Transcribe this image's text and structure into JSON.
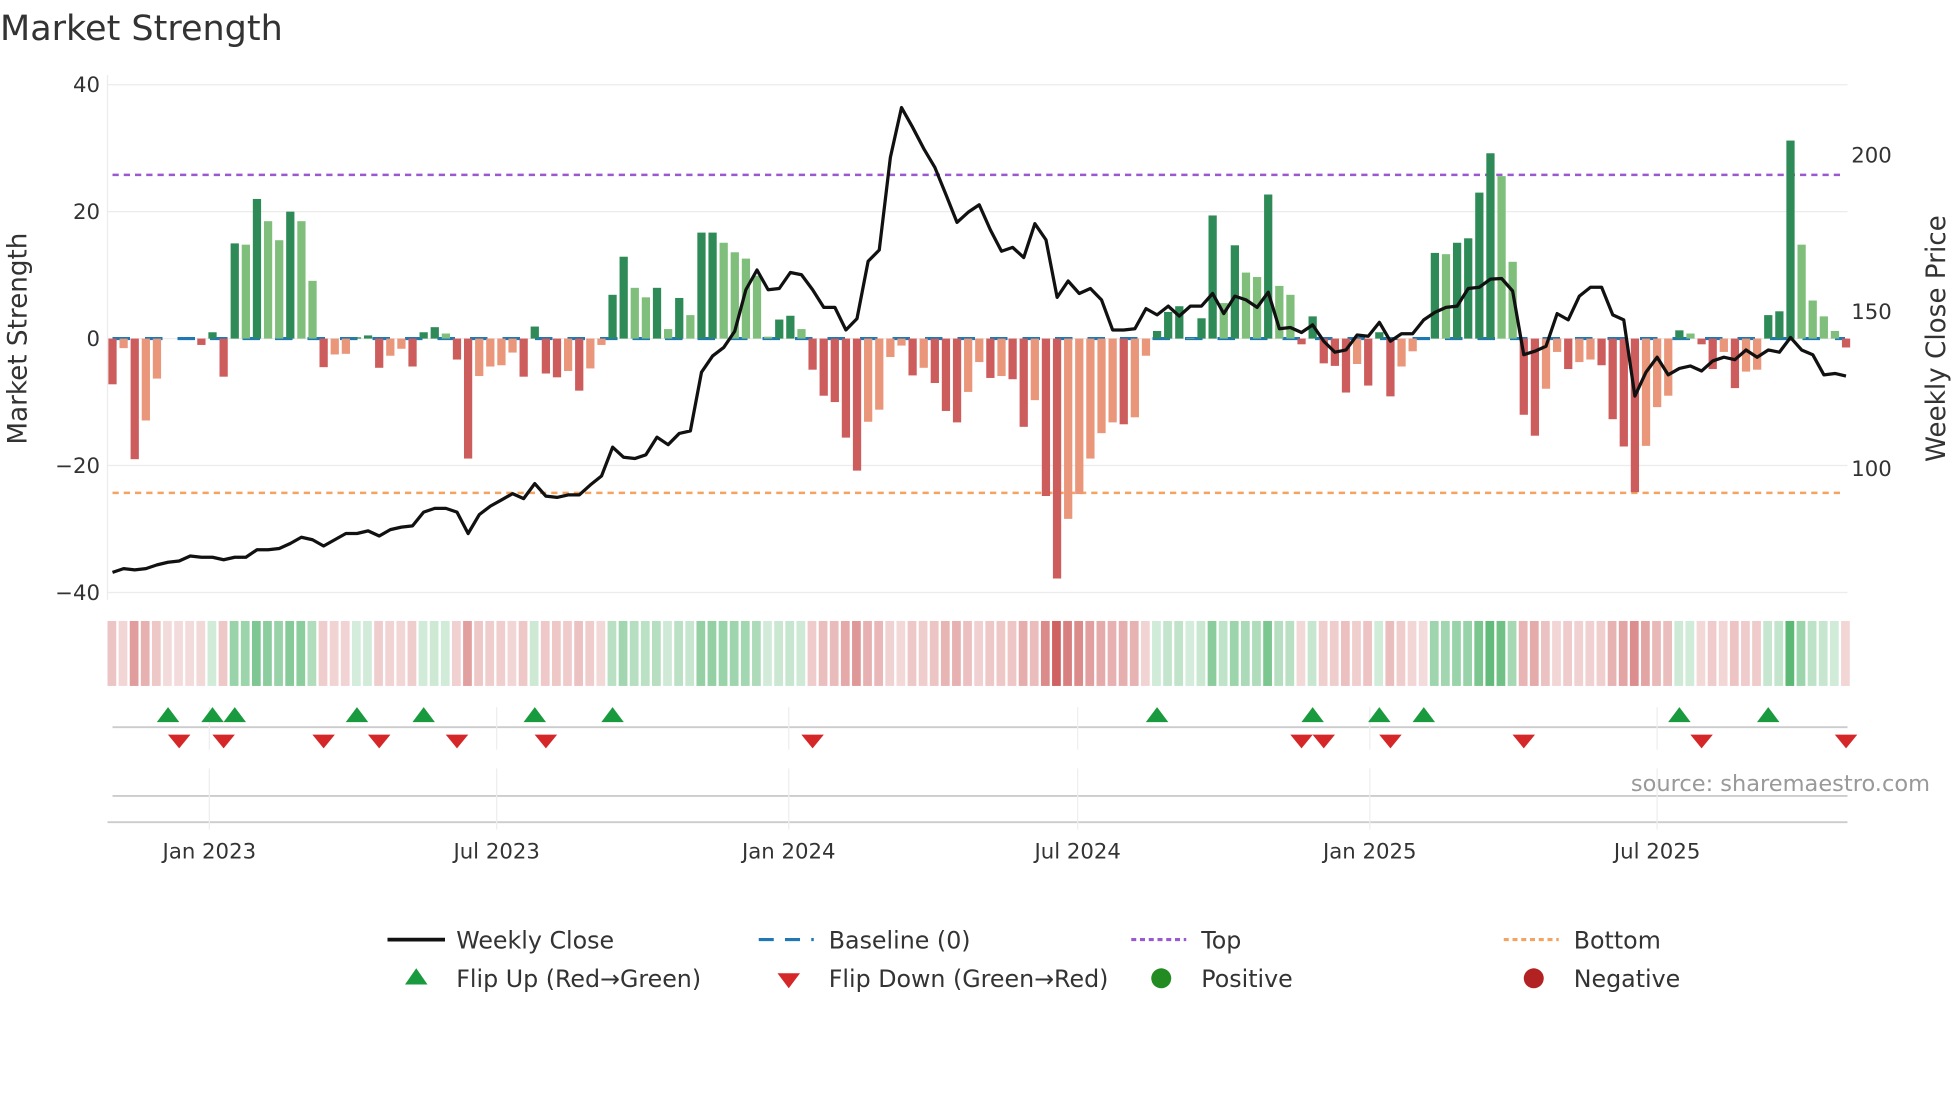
{
  "chart_data": {
    "type": "bar",
    "title": "Market Strength",
    "ylabel_left": "Market Strength",
    "ylabel_right": "Weekly Close Price",
    "ylim_left": [
      -40,
      40
    ],
    "left_ticks": [
      40,
      20,
      0,
      -20,
      -40
    ],
    "left_tick_labels": [
      "40",
      "20",
      "0",
      "−20",
      "−40"
    ],
    "right_ticks": [
      200,
      150,
      100
    ],
    "right_tick_labels": [
      "200",
      "150",
      "100"
    ],
    "x_tick_dates": [
      "2023-01-01",
      "2023-07-01",
      "2024-01-01",
      "2024-07-01",
      "2025-01-01",
      "2025-07-01"
    ],
    "x_tick_labels": [
      "Jan 2023",
      "Jul 2023",
      "Jan 2024",
      "Jul 2024",
      "Jan 2025",
      "Jul 2025"
    ],
    "start_date": "2022-11-01",
    "frequency": "weekly",
    "top_level": 25.8,
    "bottom_level": -24.3,
    "baseline": 0,
    "strength": [
      -7.2,
      -1.5,
      -19,
      -12.9,
      -6.3,
      0,
      0,
      0,
      -1,
      1,
      -6,
      15,
      14.8,
      22,
      18.5,
      15.5,
      20,
      18.5,
      9.1,
      -4.5,
      -2.5,
      -2.4,
      0.2,
      0.5,
      -4.6,
      -2.7,
      -1.6,
      -4.4,
      1,
      1.8,
      0.8,
      -3.3,
      -18.9,
      -5.9,
      -4.4,
      -4.2,
      -2.2,
      -6,
      1.9,
      -5.5,
      -6.1,
      -5.1,
      -8.2,
      -4.7,
      -1,
      6.9,
      12.9,
      8,
      6.5,
      8,
      1.5,
      6.4,
      3.7,
      16.7,
      16.7,
      15.1,
      13.6,
      12.6,
      9.9,
      0.3,
      3,
      3.6,
      1.5,
      -4.9,
      -9,
      -10,
      -15.6,
      -20.8,
      -13.1,
      -11.2,
      -2.9,
      -1.1,
      -5.8,
      -4.6,
      -7,
      -11.4,
      -13.2,
      -8.4,
      -3.7,
      -6.2,
      -5.9,
      -6.4,
      -13.9,
      -9.7,
      -24.8,
      -37.8,
      -28.4,
      -24.5,
      -18.9,
      -14.9,
      -13.2,
      -13.5,
      -12.4,
      -2.7,
      1.2,
      4.2,
      5.1,
      0.1,
      3.2,
      19.4,
      5.6,
      14.7,
      10.4,
      9.7,
      22.7,
      8.3,
      6.9,
      -0.9,
      3.5,
      -3.9,
      -4.3,
      -8.5,
      -4,
      -7.4,
      1,
      -9.1,
      -4.4,
      -2,
      0,
      13.5,
      13.3,
      15.1,
      15.8,
      23,
      29.2,
      25.6,
      12.1,
      -12,
      -15.3,
      -7.9,
      -2.1,
      -4.8,
      -3.7,
      -3.3,
      -4.2,
      -12.7,
      -17,
      -24.2,
      -16.9,
      -10.8,
      -9,
      1.3,
      0.8,
      -0.9,
      -4.8,
      -2.1,
      -7.8,
      -5.2,
      -4.9,
      3.7,
      4.3,
      31.2,
      14.8,
      6,
      3.5,
      1.2,
      -1.4
    ],
    "close": [
      66.9,
      68.1,
      67.7,
      68.1,
      69.3,
      70.1,
      70.5,
      72.1,
      71.7,
      71.7,
      70.9,
      71.7,
      71.7,
      74.1,
      74.1,
      74.5,
      76.1,
      78.1,
      77.3,
      75.3,
      77.3,
      79.3,
      79.3,
      80.1,
      78.5,
      80.5,
      81.3,
      81.7,
      86.1,
      87.3,
      87.3,
      86.1,
      79.3,
      85.3,
      88,
      90,
      92,
      90.4,
      95.2,
      91.2,
      90.8,
      91.6,
      91.6,
      94.8,
      97.6,
      106.8,
      103.6,
      103.2,
      104.4,
      110,
      107.6,
      111.2,
      112,
      130.7,
      135.9,
      138.6,
      143.8,
      157,
      163.3,
      157,
      157.4,
      162.5,
      161.8,
      157,
      151.4,
      151.4,
      144.2,
      147.8,
      166.1,
      169.7,
      199.2,
      215.1,
      208.8,
      202,
      196,
      187.3,
      178.5,
      181.7,
      184.1,
      176.1,
      169.3,
      170.5,
      167.3,
      178.1,
      172.9,
      154.6,
      159.8,
      155.8,
      157.4,
      153.8,
      144.2,
      144.2,
      144.6,
      151,
      149,
      151.8,
      148.6,
      151.8,
      151.8,
      155.8,
      149.4,
      155,
      153.8,
      151.4,
      156.2,
      144.6,
      145,
      143.4,
      145.8,
      140.6,
      137.1,
      137.8,
      142.6,
      142.2,
      146.6,
      140.6,
      143,
      143,
      147.4,
      149.8,
      151.4,
      151.8,
      157.4,
      157.8,
      160.4,
      160.6,
      156.6,
      136.3,
      137.4,
      139,
      149.4,
      147.4,
      155,
      157.8,
      157.8,
      149,
      147.4,
      123.1,
      130.7,
      135.5,
      129.9,
      131.9,
      132.7,
      131.1,
      134.3,
      135.5,
      134.7,
      137.8,
      135.5,
      137.8,
      137.1,
      141.8,
      137.8,
      136.3,
      129.9,
      130.3,
      129.5
    ],
    "flip_up_weeks": [
      5,
      9,
      11,
      22,
      28,
      38,
      45,
      94,
      108,
      114,
      118,
      141,
      149
    ],
    "flip_down_weeks": [
      6,
      10,
      19,
      24,
      31,
      39,
      63,
      107,
      109,
      115,
      127,
      143,
      156
    ],
    "legend": {
      "placement": "bottom",
      "entries": [
        "Weekly Close",
        "Baseline (0)",
        "Top",
        "Bottom",
        "Flip Up (Red→Green)",
        "Flip Down (Green→Red)",
        "Positive",
        "Negative"
      ]
    },
    "source": "source: sharemaestro.com",
    "colors": {
      "pos_rising": "#2e8b57",
      "pos_falling": "#7fbf7b",
      "neg_falling": "#cd5c5c",
      "neg_rising": "#e9967a",
      "baseline": "#1f77b4",
      "top": "#9b59d0",
      "bottom": "#f4a460",
      "close": "#111111",
      "flip_up": "#1a9a3e",
      "flip_down": "#d62728",
      "positive": "#228b22",
      "negative": "#b22222"
    }
  }
}
